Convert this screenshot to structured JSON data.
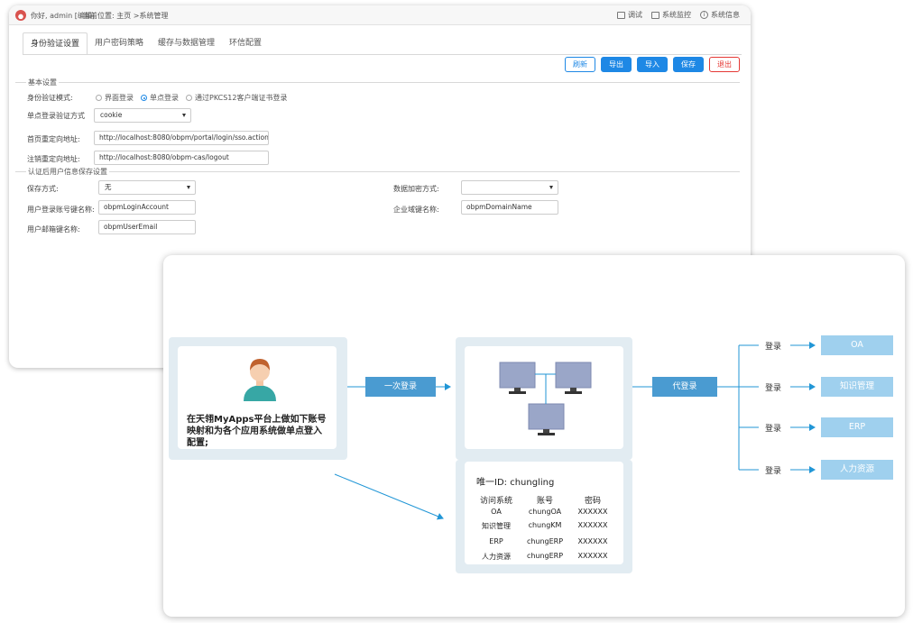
{
  "topbar": {
    "greeting": "你好, admin [编辑]",
    "breadcrumb": "当前位置: 主页 >系统管理",
    "debug": "调试",
    "monitor": "系统监控",
    "info": "系统信息"
  },
  "tabs": [
    "身份验证设置",
    "用户密码策略",
    "缓存与数据管理",
    "环信配置"
  ],
  "buttons": {
    "refresh": "刷新",
    "export": "导出",
    "import": "导入",
    "save": "保存",
    "exit": "退出"
  },
  "basic": {
    "section": "基本设置",
    "mode_label": "身份验证模式:",
    "modes": [
      "界面登录",
      "单点登录",
      "通过PKCS12客户端证书登录"
    ],
    "sso_label": "单点登录验证方式",
    "sso_value": "cookie",
    "home_label": "首页重定向地址:",
    "home_value": "http://localhost:8080/obpm/portal/login/sso.action",
    "logout_label": "注销重定向地址:",
    "logout_value": "http://localhost:8080/obpm-cas/logout"
  },
  "after": {
    "section": "认证后用户信息保存设置",
    "save_label": "保存方式:",
    "save_value": "无",
    "encrypt_label": "数据加密方式:",
    "encrypt_value": "",
    "account_label": "用户登录账号键名称:",
    "account_value": "obpmLoginAccount",
    "domain_label": "企业域键名称:",
    "domain_value": "obpmDomainName",
    "email_label": "用户邮箱键名称:",
    "email_value": "obpmUserEmail"
  },
  "diagram": {
    "description": "在天翎MyApps平台上做如下账号映射和为各个应用系统做单点登入配置;",
    "first_login": "一次登录",
    "proxy_login": "代登录",
    "login_word": "登录",
    "unique_id": "唯一ID: chungling",
    "headers": [
      "访问系统",
      "账号",
      "密码"
    ],
    "rows": [
      [
        "OA",
        "chungOA",
        "XXXXXX"
      ],
      [
        "知识管理",
        "chungKM",
        "XXXXXX"
      ],
      [
        "ERP",
        "chungERP",
        "XXXXXX"
      ],
      [
        "人力资源",
        "chungERP",
        "XXXXXX"
      ]
    ],
    "systems": [
      "OA",
      "知识管理",
      "ERP",
      "人力资源"
    ],
    "colors": {
      "panel": "#e2ecf2",
      "label": "#4a9bd1",
      "system": "#9fd0ee",
      "arrow": "#2196d6"
    }
  }
}
